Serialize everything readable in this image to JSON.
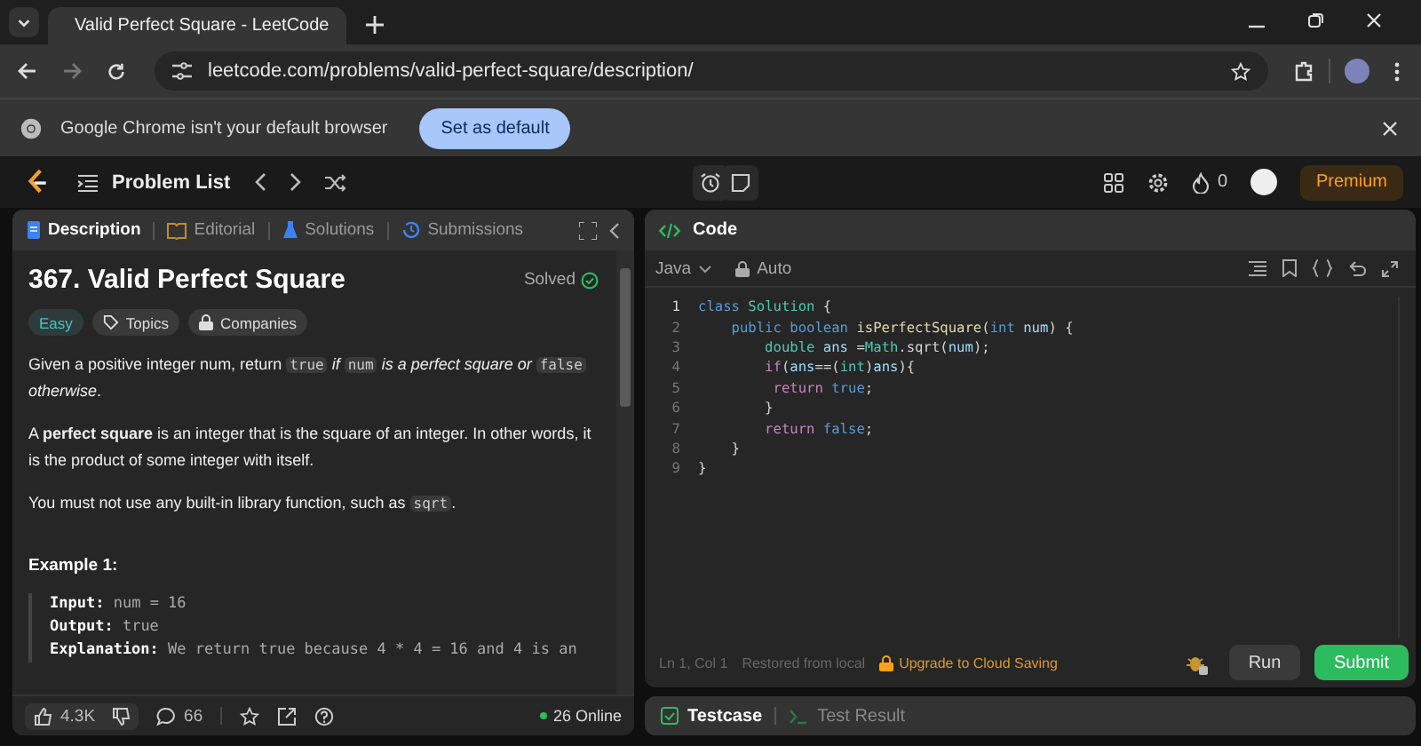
{
  "browser": {
    "tab_title": "Valid Perfect Square - LeetCode",
    "url": "leetcode.com/problems/valid-perfect-square/description/",
    "infobar_message": "Google Chrome isn't your default browser",
    "infobar_button": "Set as default"
  },
  "nav": {
    "problem_list": "Problem List",
    "streak": "0",
    "premium": "Premium"
  },
  "left_tabs": [
    {
      "label": "Description",
      "selected": true,
      "kind": "description"
    },
    {
      "label": "Editorial",
      "selected": false,
      "kind": "editorial"
    },
    {
      "label": "Solutions",
      "selected": false,
      "kind": "solutions"
    },
    {
      "label": "Submissions",
      "selected": false,
      "kind": "submissions"
    }
  ],
  "problem": {
    "title": "367. Valid Perfect Square",
    "status": "Solved",
    "difficulty": "Easy",
    "tags": [
      {
        "label": "Topics",
        "kind": "topics"
      },
      {
        "label": "Companies",
        "kind": "companies"
      }
    ],
    "paragraphs": [
      [
        {
          "text": "Given a positive integer num, return "
        },
        {
          "text": "true",
          "kind": "code"
        },
        {
          "text": " if ",
          "kind": "italic"
        },
        {
          "text": "num",
          "kind": "code"
        },
        {
          "text": " is a perfect square or ",
          "kind": "italic"
        },
        {
          "text": "false",
          "kind": "code"
        },
        {
          "text": " otherwise",
          "kind": "italic"
        },
        {
          "text": "."
        }
      ],
      [
        {
          "text": "A "
        },
        {
          "text": "perfect square",
          "kind": "bold"
        },
        {
          "text": " is an integer that is the square of an integer. In other words, it is the product of some integer with itself."
        }
      ],
      [
        {
          "text": "You must not use any built-in library function, such as "
        },
        {
          "text": "sqrt",
          "kind": "code"
        },
        {
          "text": "."
        }
      ]
    ],
    "example_title": "Example 1:",
    "example_lines": [
      {
        "label": "Input:",
        "value": "num = 16"
      },
      {
        "label": "Output:",
        "value": "true"
      },
      {
        "label": "Explanation:",
        "value": "We return true because 4 * 4 = 16 and 4 is an"
      }
    ]
  },
  "left_footer": {
    "likes": "4.3K",
    "comments": "66",
    "online": "26 Online"
  },
  "editor": {
    "title": "Code",
    "language": "Java",
    "mode": "Auto",
    "lines": [
      {
        "number": "1",
        "tokens": [
          {
            "text": "class",
            "kind": "kw"
          },
          {
            "text": " Solution",
            "kind": "type"
          },
          {
            "text": " {"
          }
        ]
      },
      {
        "number": "2",
        "tokens": [
          {
            "text": "    public boolean",
            "kind": "kw"
          },
          {
            "text": " isPerfectSquare",
            "kind": "fn"
          },
          {
            "text": "("
          },
          {
            "text": "int",
            "kind": "kw"
          },
          {
            "text": " num",
            "kind": "var"
          },
          {
            "text": ") {"
          }
        ]
      },
      {
        "number": "3",
        "tokens": [
          {
            "text": "        double",
            "kind": "type"
          },
          {
            "text": " ans",
            "kind": "var"
          },
          {
            "text": " ="
          },
          {
            "text": "Math",
            "kind": "type"
          },
          {
            "text": ".sqrt("
          },
          {
            "text": "num",
            "kind": "var"
          },
          {
            "text": ");"
          }
        ]
      },
      {
        "number": "4",
        "tokens": [
          {
            "text": "        if",
            "kind": "ctl"
          },
          {
            "text": "("
          },
          {
            "text": "ans",
            "kind": "var"
          },
          {
            "text": "==("
          },
          {
            "text": "int",
            "kind": "type"
          },
          {
            "text": ")"
          },
          {
            "text": "ans",
            "kind": "var"
          },
          {
            "text": "){"
          }
        ]
      },
      {
        "number": "5",
        "tokens": [
          {
            "text": "         return",
            "kind": "ctl"
          },
          {
            "text": " true",
            "kind": "kw"
          },
          {
            "text": ";"
          }
        ]
      },
      {
        "number": "6",
        "tokens": [
          {
            "text": "        }"
          }
        ]
      },
      {
        "number": "7",
        "tokens": [
          {
            "text": "        return",
            "kind": "ctl"
          },
          {
            "text": " false",
            "kind": "kw"
          },
          {
            "text": ";"
          }
        ]
      },
      {
        "number": "8",
        "tokens": [
          {
            "text": "    }"
          }
        ]
      },
      {
        "number": "9",
        "tokens": [
          {
            "text": "}"
          }
        ]
      }
    ],
    "cursor": "Ln 1, Col 1",
    "restore_note": "Restored from local",
    "upgrade_link": "Upgrade to Cloud Saving",
    "run": "Run",
    "submit": "Submit"
  },
  "bottom_tabs": [
    {
      "label": "Testcase",
      "selected": true,
      "kind": "testcase"
    },
    {
      "label": "Test Result",
      "selected": false,
      "kind": "result"
    }
  ]
}
